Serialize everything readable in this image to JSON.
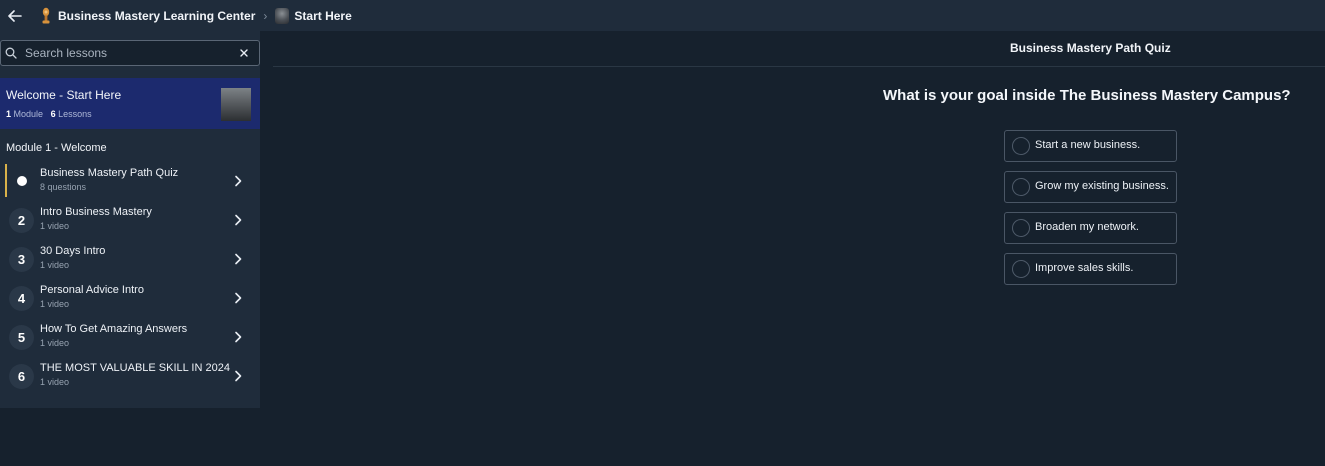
{
  "breadcrumb": {
    "campus": "Business Mastery Learning Center",
    "separator": "›",
    "page": "Start Here"
  },
  "sidebar": {
    "search": {
      "placeholder": "Search lessons",
      "value": ""
    },
    "course": {
      "title": "Welcome - Start Here",
      "module_count": "1",
      "module_label": "Module",
      "lesson_count": "6",
      "lesson_label": "Lessons"
    },
    "module_title": "Module 1 - Welcome",
    "lessons": [
      {
        "num": "",
        "name": "Business Mastery Path Quiz",
        "sub": "8 questions",
        "active": true
      },
      {
        "num": "2",
        "name": "Intro Business Mastery",
        "sub": "1 video"
      },
      {
        "num": "3",
        "name": "30 Days Intro",
        "sub": "1 video"
      },
      {
        "num": "4",
        "name": "Personal Advice Intro",
        "sub": "1 video"
      },
      {
        "num": "5",
        "name": "How To Get Amazing Answers",
        "sub": "1 video"
      },
      {
        "num": "6",
        "name": "THE MOST VALUABLE SKILL IN 2024",
        "sub": "1 video"
      }
    ]
  },
  "main": {
    "quiz_title": "Business Mastery Path Quiz",
    "question": "What is your goal inside The Business Mastery Campus?",
    "options": [
      "Start a new business.",
      "Grow my existing business.",
      "Broaden my network.",
      "Improve sales skills."
    ]
  },
  "colors": {
    "background": "#16212d",
    "sidebar": "#1f2c3b",
    "course_card": "#1c2a6e",
    "active_accent": "#d9b24a"
  },
  "icons": {
    "back": "arrow-left-icon",
    "campus": "trophy-icon",
    "search": "search-icon",
    "clear": "close-icon",
    "chevron": "chevron-right-icon"
  }
}
